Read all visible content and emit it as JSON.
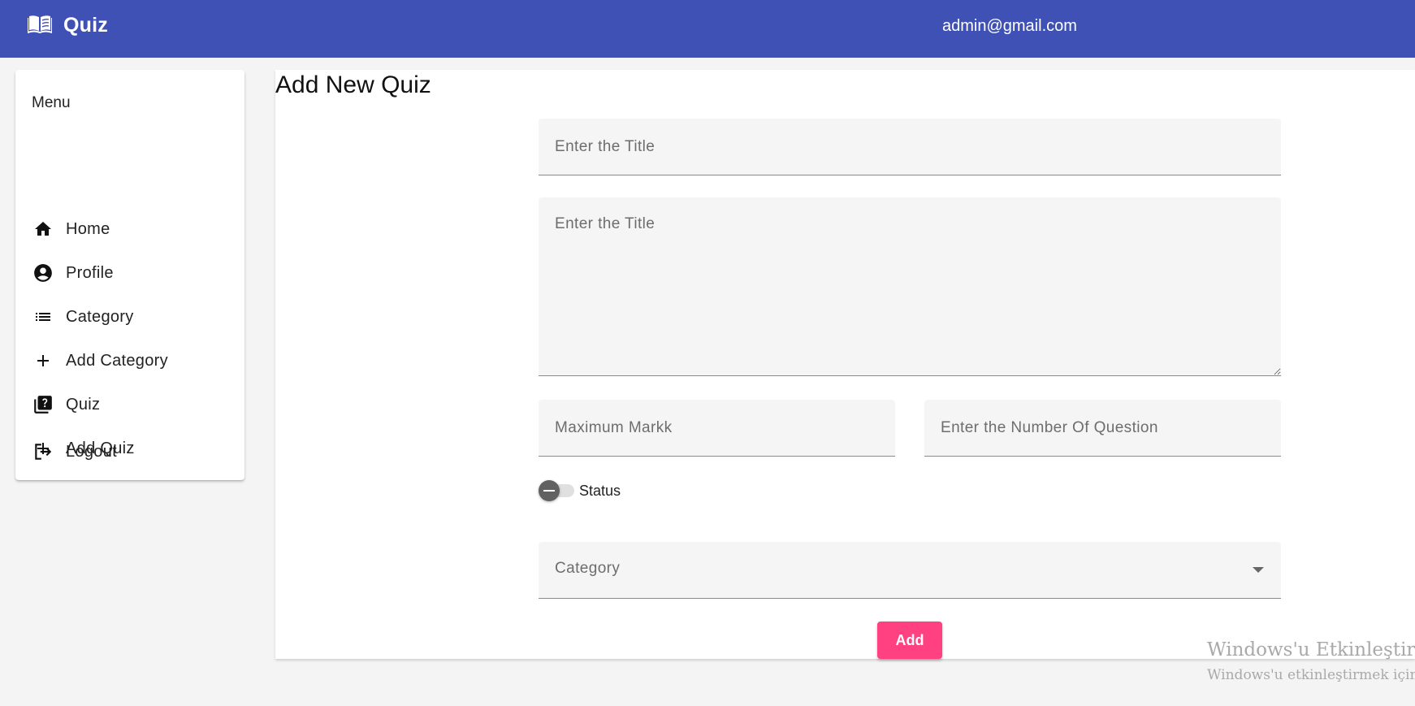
{
  "app": {
    "title": "Quiz"
  },
  "header": {
    "user_email": "admin@gmail.com"
  },
  "sidebar": {
    "header": "Menu",
    "items": [
      {
        "label": "Home",
        "icon": "home-icon"
      },
      {
        "label": "Profile",
        "icon": "account-circle-icon"
      },
      {
        "label": "Category",
        "icon": "list-icon"
      },
      {
        "label": "Add Category",
        "icon": "plus-icon"
      },
      {
        "label": "Quiz",
        "icon": "quiz-icon"
      },
      {
        "label": "Add Quiz",
        "icon": "plus-icon"
      },
      {
        "label": "Logout",
        "icon": "logout-icon"
      }
    ]
  },
  "form": {
    "page_title": "Add New Quiz",
    "title_placeholder": "Enter the Title",
    "description_placeholder": "Enter the Title",
    "max_marks_placeholder": "Maximum Markk",
    "num_questions_placeholder": "Enter the Number Of Question",
    "status_label": "Status",
    "category_label": "Category",
    "add_button_label": "Add"
  },
  "watermark": {
    "line1": "Windows'u Etkinleştir",
    "line2": "Windows'u etkinleştirmek için Ay"
  }
}
